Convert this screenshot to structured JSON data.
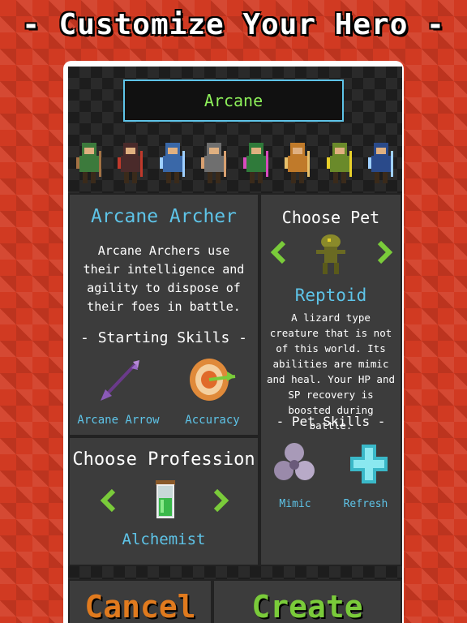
{
  "banner": "- Customize Your Hero -",
  "hero_name": "Arcane",
  "heroes": [
    {
      "icon": "green-hood-hero-icon",
      "color": "#3c7a3c",
      "accent": "#a37244"
    },
    {
      "icon": "red-dark-hero-icon",
      "color": "#4a2a2a",
      "accent": "#c0392b"
    },
    {
      "icon": "blue-mage-hero-icon",
      "color": "#3a68a8",
      "accent": "#9fd0ff"
    },
    {
      "icon": "grey-hood-hero-icon",
      "color": "#6f6f6f",
      "accent": "#d8a070"
    },
    {
      "icon": "mohawk-warrior-icon",
      "color": "#2f7a3a",
      "accent": "#d84bbd"
    },
    {
      "icon": "orange-archer-icon",
      "color": "#c07a2a",
      "accent": "#e8c06a"
    },
    {
      "icon": "goblin-icon",
      "color": "#6a8a2a",
      "accent": "#e8d02a"
    },
    {
      "icon": "blue-archer-icon",
      "color": "#2a4a8a",
      "accent": "#9fd0ff"
    }
  ],
  "class_panel": {
    "title": "Arcane Archer",
    "description": "Arcane Archers use their intelligence and agility to dispose of their foes in battle.",
    "skills_heading": "- Starting Skills -",
    "skills": [
      "Arcane Arrow",
      "Accuracy"
    ]
  },
  "pet_panel": {
    "heading": "Choose Pet",
    "pet_name": "Reptoid",
    "description": "A lizard type creature that is not of this world. Its abilities are mimic and heal. Your HP and SP recovery is boosted during battle.",
    "skills_heading": "- Pet Skills -",
    "skills": [
      "Mimic",
      "Refresh"
    ]
  },
  "profession_panel": {
    "heading": "Choose Profession",
    "profession_name": "Alchemist"
  },
  "buttons": {
    "cancel": "Cancel",
    "create": "Create"
  },
  "colors": {
    "accent_blue": "#5ec4e8",
    "accent_green": "#8df05a",
    "cancel_orange": "#e07a1e"
  }
}
